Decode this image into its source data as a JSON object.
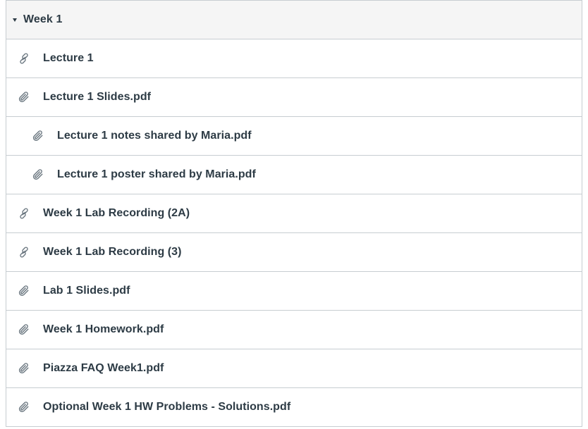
{
  "module": {
    "title": "Week 1",
    "items": [
      {
        "label": "Lecture 1",
        "icon": "link-icon",
        "indent": false
      },
      {
        "label": "Lecture 1 Slides.pdf",
        "icon": "paperclip-icon",
        "indent": false
      },
      {
        "label": "Lecture 1 notes shared by Maria.pdf",
        "icon": "paperclip-icon",
        "indent": true
      },
      {
        "label": "Lecture 1 poster shared by Maria.pdf",
        "icon": "paperclip-icon",
        "indent": true
      },
      {
        "label": "Week 1 Lab Recording (2A)",
        "icon": "link-icon",
        "indent": false
      },
      {
        "label": "Week 1 Lab Recording (3)",
        "icon": "link-icon",
        "indent": false
      },
      {
        "label": "Lab 1 Slides.pdf",
        "icon": "paperclip-icon",
        "indent": false
      },
      {
        "label": "Week 1 Homework.pdf",
        "icon": "paperclip-icon",
        "indent": false
      },
      {
        "label": "Piazza FAQ Week1.pdf",
        "icon": "paperclip-icon",
        "indent": false
      },
      {
        "label": "Optional Week 1 HW Problems - Solutions.pdf",
        "icon": "paperclip-icon",
        "indent": false
      }
    ]
  },
  "colors": {
    "text": "#2d3b45",
    "border": "#c7cdd1",
    "header_bg": "#f5f5f5",
    "icon": "#6b7780"
  }
}
